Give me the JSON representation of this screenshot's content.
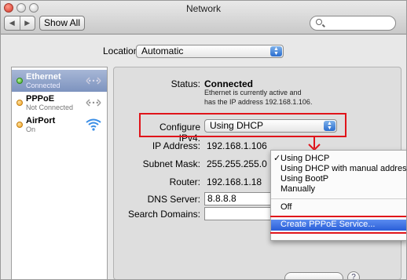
{
  "window": {
    "title": "Network"
  },
  "toolbar": {
    "back": "◀",
    "forward": "▶",
    "show_all": "Show All"
  },
  "location": {
    "label": "Location:",
    "value": "Automatic"
  },
  "services": [
    {
      "name": "Ethernet",
      "status": "Connected",
      "dot": "green",
      "icon": "ethernet-icon",
      "selected": true
    },
    {
      "name": "PPPoE",
      "status": "Not Connected",
      "dot": "amber",
      "icon": "pppoe-icon",
      "selected": false
    },
    {
      "name": "AirPort",
      "status": "On",
      "dot": "amber",
      "icon": "wifi-icon",
      "selected": false
    }
  ],
  "detail": {
    "status_label": "Status:",
    "status_value": "Connected",
    "status_note": "Ethernet is currently active and has the IP address 192.168.1.106.",
    "configure_label": "Configure IPv4:",
    "configure_value": "Using DHCP",
    "ip_label": "IP Address:",
    "ip_value": "192.168.1.106",
    "subnet_label": "Subnet Mask:",
    "subnet_value": "255.255.255.0",
    "router_label": "Router:",
    "router_value": "192.168.1.18",
    "dns_label": "DNS Server:",
    "dns_value": "8.8.8.8",
    "search_label": "Search Domains:",
    "search_value": ""
  },
  "menu": {
    "items": [
      {
        "label": "Using DHCP",
        "checked": true
      },
      {
        "label": "Using DHCP with manual address"
      },
      {
        "label": "Using BootP"
      },
      {
        "label": "Manually"
      },
      {
        "label": "Off"
      },
      {
        "label": "Create PPPoE Service...",
        "highlighted": true
      }
    ],
    "check": "✓"
  },
  "colors": {
    "annotation": "#e0141a",
    "selection": "#2a5ed8",
    "sidebar_selected": "#8ea2c9"
  },
  "help": "?"
}
